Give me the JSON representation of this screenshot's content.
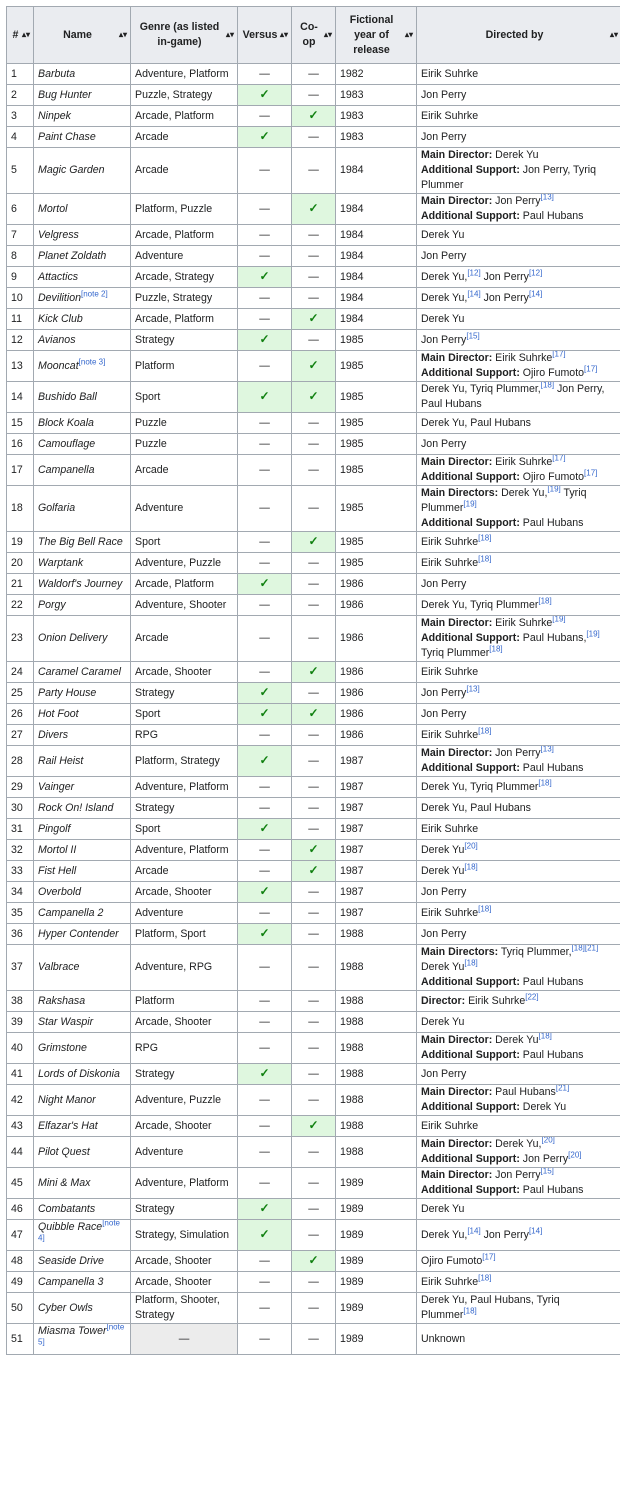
{
  "headers": [
    {
      "key": "num",
      "label": "#"
    },
    {
      "key": "name",
      "label": "Name"
    },
    {
      "key": "genre",
      "label": "Genre (as listed in-game)"
    },
    {
      "key": "versus",
      "label": "Versus"
    },
    {
      "key": "coop",
      "label": "Co-op"
    },
    {
      "key": "year",
      "label": "Fictional year of release"
    },
    {
      "key": "directed",
      "label": "Directed by"
    }
  ],
  "sort_icon": "sort-updown-icon",
  "check_symbol": "✓",
  "dash_symbol": "—",
  "colors": {
    "check_bg": "#dff7df",
    "mark_bg": "#ececec",
    "check_fg": "#108010",
    "link": "#3366cc",
    "header_bg": "#eaecf0",
    "border": "#a2a9b1"
  },
  "rows": [
    {
      "num": "1",
      "name": "Barbuta",
      "genre": "Adventure, Platform",
      "versus": false,
      "coop": false,
      "year": "1982",
      "directed": [
        [
          {
            "t": "Eirik Suhrke"
          }
        ]
      ]
    },
    {
      "num": "2",
      "name": "Bug Hunter",
      "genre": "Puzzle, Strategy",
      "versus": true,
      "coop": false,
      "year": "1983",
      "directed": [
        [
          {
            "t": "Jon Perry"
          }
        ]
      ]
    },
    {
      "num": "3",
      "name": "Ninpek",
      "genre": "Arcade, Platform",
      "versus": false,
      "coop": true,
      "year": "1983",
      "directed": [
        [
          {
            "t": "Eirik Suhrke"
          }
        ]
      ]
    },
    {
      "num": "4",
      "name": "Paint Chase",
      "genre": "Arcade",
      "versus": true,
      "coop": false,
      "year": "1983",
      "directed": [
        [
          {
            "t": "Jon Perry"
          }
        ]
      ]
    },
    {
      "num": "5",
      "name": "Magic Garden",
      "genre": "Arcade",
      "versus": false,
      "coop": false,
      "year": "1984",
      "directed": [
        [
          {
            "b": "Main Director:"
          },
          {
            "t": " Derek Yu"
          }
        ],
        [
          {
            "b": "Additional Support:"
          },
          {
            "t": " Jon Perry, Tyriq Plummer"
          }
        ]
      ]
    },
    {
      "num": "6",
      "name": "Mortol",
      "genre": "Platform, Puzzle",
      "versus": false,
      "coop": true,
      "year": "1984",
      "directed": [
        [
          {
            "b": "Main Director:"
          },
          {
            "t": " Jon Perry"
          },
          {
            "s": "[13]"
          }
        ],
        [
          {
            "b": "Additional Support:"
          },
          {
            "t": " Paul Hubans"
          }
        ]
      ]
    },
    {
      "num": "7",
      "name": "Velgress",
      "genre": "Arcade, Platform",
      "versus": false,
      "coop": false,
      "year": "1984",
      "directed": [
        [
          {
            "t": "Derek Yu"
          }
        ]
      ]
    },
    {
      "num": "8",
      "name": "Planet Zoldath",
      "genre": "Adventure",
      "versus": false,
      "coop": false,
      "year": "1984",
      "directed": [
        [
          {
            "t": "Jon Perry"
          }
        ]
      ]
    },
    {
      "num": "9",
      "name": "Attactics",
      "genre": "Arcade, Strategy",
      "versus": true,
      "coop": false,
      "year": "1984",
      "directed": [
        [
          {
            "t": "Derek Yu,"
          },
          {
            "s": "[12]"
          },
          {
            "t": " Jon Perry"
          },
          {
            "s": "[12]"
          }
        ]
      ]
    },
    {
      "num": "10",
      "name": "Devilition",
      "name_sup": "[note 2]",
      "genre": "Puzzle, Strategy",
      "versus": false,
      "coop": false,
      "year": "1984",
      "directed": [
        [
          {
            "t": "Derek Yu,"
          },
          {
            "s": "[14]"
          },
          {
            "t": " Jon Perry"
          },
          {
            "s": "[14]"
          }
        ]
      ]
    },
    {
      "num": "11",
      "name": "Kick Club",
      "genre": "Arcade, Platform",
      "versus": false,
      "coop": true,
      "year": "1984",
      "directed": [
        [
          {
            "t": "Derek Yu"
          }
        ]
      ]
    },
    {
      "num": "12",
      "name": "Avianos",
      "genre": "Strategy",
      "versus": true,
      "coop": false,
      "year": "1985",
      "directed": [
        [
          {
            "t": "Jon Perry"
          },
          {
            "s": "[15]"
          }
        ]
      ]
    },
    {
      "num": "13",
      "name": "Mooncat",
      "name_sup": "[note 3]",
      "genre": "Platform",
      "versus": false,
      "coop": true,
      "year": "1985",
      "directed": [
        [
          {
            "b": "Main Director:"
          },
          {
            "t": " Eirik Suhrke"
          },
          {
            "s": "[17]"
          }
        ],
        [
          {
            "b": "Additional Support:"
          },
          {
            "t": " Ojiro Fumoto"
          },
          {
            "s": "[17]"
          }
        ]
      ]
    },
    {
      "num": "14",
      "name": "Bushido Ball",
      "genre": "Sport",
      "versus": true,
      "coop": true,
      "year": "1985",
      "directed": [
        [
          {
            "t": "Derek Yu, Tyriq Plummer,"
          },
          {
            "s": "[18]"
          },
          {
            "t": " Jon Perry, Paul Hubans"
          }
        ]
      ]
    },
    {
      "num": "15",
      "name": "Block Koala",
      "genre": "Puzzle",
      "versus": false,
      "coop": false,
      "year": "1985",
      "directed": [
        [
          {
            "t": "Derek Yu, Paul Hubans"
          }
        ]
      ]
    },
    {
      "num": "16",
      "name": "Camouflage",
      "genre": "Puzzle",
      "versus": false,
      "coop": false,
      "year": "1985",
      "directed": [
        [
          {
            "t": "Jon Perry"
          }
        ]
      ]
    },
    {
      "num": "17",
      "name": "Campanella",
      "genre": "Arcade",
      "versus": false,
      "coop": false,
      "year": "1985",
      "directed": [
        [
          {
            "b": "Main Director:"
          },
          {
            "t": " Eirik Suhrke"
          },
          {
            "s": "[17]"
          }
        ],
        [
          {
            "b": "Additional Support:"
          },
          {
            "t": " Ojiro Fumoto"
          },
          {
            "s": "[17]"
          }
        ]
      ]
    },
    {
      "num": "18",
      "name": "Golfaria",
      "genre": "Adventure",
      "versus": false,
      "coop": false,
      "year": "1985",
      "directed": [
        [
          {
            "b": "Main Directors:"
          },
          {
            "t": " Derek Yu,"
          },
          {
            "s": "[19]"
          },
          {
            "t": " Tyriq Plummer"
          },
          {
            "s": "[19]"
          }
        ],
        [
          {
            "b": "Additional Support:"
          },
          {
            "t": " Paul Hubans"
          }
        ]
      ]
    },
    {
      "num": "19",
      "name": "The Big Bell Race",
      "genre": "Sport",
      "versus": false,
      "coop": true,
      "year": "1985",
      "directed": [
        [
          {
            "t": "Eirik Suhrke"
          },
          {
            "s": "[18]"
          }
        ]
      ]
    },
    {
      "num": "20",
      "name": "Warptank",
      "genre": "Adventure, Puzzle",
      "versus": false,
      "coop": false,
      "year": "1985",
      "directed": [
        [
          {
            "t": "Eirik Suhrke"
          },
          {
            "s": "[18]"
          }
        ]
      ]
    },
    {
      "num": "21",
      "name": "Waldorf's Journey",
      "genre": "Arcade, Platform",
      "versus": true,
      "coop": false,
      "year": "1986",
      "directed": [
        [
          {
            "t": "Jon Perry"
          }
        ]
      ]
    },
    {
      "num": "22",
      "name": "Porgy",
      "genre": "Adventure, Shooter",
      "versus": false,
      "coop": false,
      "year": "1986",
      "directed": [
        [
          {
            "t": "Derek Yu, Tyriq Plummer"
          },
          {
            "s": "[18]"
          }
        ]
      ]
    },
    {
      "num": "23",
      "name": "Onion Delivery",
      "genre": "Arcade",
      "versus": false,
      "coop": false,
      "year": "1986",
      "directed": [
        [
          {
            "b": "Main Director:"
          },
          {
            "t": " Eirik Suhrke"
          },
          {
            "s": "[19]"
          }
        ],
        [
          {
            "b": "Additional Support:"
          },
          {
            "t": " Paul Hubans,"
          },
          {
            "s": "[19]"
          },
          {
            "t": " Tyriq Plummer"
          },
          {
            "s": "[18]"
          }
        ]
      ]
    },
    {
      "num": "24",
      "name": "Caramel Caramel",
      "genre": "Arcade, Shooter",
      "versus": false,
      "coop": true,
      "year": "1986",
      "directed": [
        [
          {
            "t": "Eirik Suhrke"
          }
        ]
      ]
    },
    {
      "num": "25",
      "name": "Party House",
      "genre": "Strategy",
      "versus": true,
      "coop": false,
      "year": "1986",
      "directed": [
        [
          {
            "t": "Jon Perry"
          },
          {
            "s": "[13]"
          }
        ]
      ]
    },
    {
      "num": "26",
      "name": "Hot Foot",
      "genre": "Sport",
      "versus": true,
      "coop": true,
      "year": "1986",
      "directed": [
        [
          {
            "t": "Jon Perry"
          }
        ]
      ]
    },
    {
      "num": "27",
      "name": "Divers",
      "genre": "RPG",
      "versus": false,
      "coop": false,
      "year": "1986",
      "directed": [
        [
          {
            "t": "Eirik Suhrke"
          },
          {
            "s": "[18]"
          }
        ]
      ]
    },
    {
      "num": "28",
      "name": "Rail Heist",
      "genre": "Platform, Strategy",
      "versus": true,
      "coop": false,
      "year": "1987",
      "directed": [
        [
          {
            "b": "Main Director:"
          },
          {
            "t": " Jon Perry"
          },
          {
            "s": "[13]"
          }
        ],
        [
          {
            "b": "Additional Support:"
          },
          {
            "t": " Paul Hubans"
          }
        ]
      ]
    },
    {
      "num": "29",
      "name": "Vainger",
      "genre": "Adventure, Platform",
      "versus": false,
      "coop": false,
      "year": "1987",
      "directed": [
        [
          {
            "t": "Derek Yu, Tyriq Plummer"
          },
          {
            "s": "[18]"
          }
        ]
      ]
    },
    {
      "num": "30",
      "name": "Rock On! Island",
      "genre": "Strategy",
      "versus": false,
      "coop": false,
      "year": "1987",
      "directed": [
        [
          {
            "t": "Derek Yu, Paul Hubans"
          }
        ]
      ]
    },
    {
      "num": "31",
      "name": "Pingolf",
      "genre": "Sport",
      "versus": true,
      "coop": false,
      "year": "1987",
      "directed": [
        [
          {
            "t": "Eirik Suhrke"
          }
        ]
      ]
    },
    {
      "num": "32",
      "name": "Mortol II",
      "genre": "Adventure, Platform",
      "versus": false,
      "coop": true,
      "year": "1987",
      "directed": [
        [
          {
            "t": "Derek Yu"
          },
          {
            "s": "[20]"
          }
        ]
      ]
    },
    {
      "num": "33",
      "name": "Fist Hell",
      "genre": "Arcade",
      "versus": false,
      "coop": true,
      "year": "1987",
      "directed": [
        [
          {
            "t": "Derek Yu"
          },
          {
            "s": "[18]"
          }
        ]
      ]
    },
    {
      "num": "34",
      "name": "Overbold",
      "genre": "Arcade, Shooter",
      "versus": true,
      "coop": false,
      "year": "1987",
      "directed": [
        [
          {
            "t": "Jon Perry"
          }
        ]
      ]
    },
    {
      "num": "35",
      "name": "Campanella 2",
      "genre": "Adventure",
      "versus": false,
      "coop": false,
      "year": "1987",
      "directed": [
        [
          {
            "t": "Eirik Suhrke"
          },
          {
            "s": "[18]"
          }
        ]
      ]
    },
    {
      "num": "36",
      "name": "Hyper Contender",
      "genre": "Platform, Sport",
      "versus": true,
      "coop": false,
      "year": "1988",
      "directed": [
        [
          {
            "t": "Jon Perry"
          }
        ]
      ]
    },
    {
      "num": "37",
      "name": "Valbrace",
      "genre": "Adventure, RPG",
      "versus": false,
      "coop": false,
      "year": "1988",
      "directed": [
        [
          {
            "b": "Main Directors:"
          },
          {
            "t": " Tyriq Plummer,"
          },
          {
            "s": "[18][21]"
          },
          {
            "t": " Derek Yu"
          },
          {
            "s": "[18]"
          }
        ],
        [
          {
            "b": "Additional Support:"
          },
          {
            "t": " Paul Hubans"
          }
        ]
      ]
    },
    {
      "num": "38",
      "name": "Rakshasa",
      "genre": "Platform",
      "versus": false,
      "coop": false,
      "year": "1988",
      "directed": [
        [
          {
            "b": "Director:"
          },
          {
            "t": " Eirik Suhrke"
          },
          {
            "s": "[22]"
          }
        ]
      ]
    },
    {
      "num": "39",
      "name": "Star Waspir",
      "genre": "Arcade, Shooter",
      "versus": false,
      "coop": false,
      "year": "1988",
      "directed": [
        [
          {
            "t": "Derek Yu"
          }
        ]
      ]
    },
    {
      "num": "40",
      "name": "Grimstone",
      "genre": "RPG",
      "versus": false,
      "coop": false,
      "year": "1988",
      "directed": [
        [
          {
            "b": "Main Director:"
          },
          {
            "t": " Derek Yu"
          },
          {
            "s": "[18]"
          }
        ],
        [
          {
            "b": "Additional Support:"
          },
          {
            "t": " Paul Hubans"
          }
        ]
      ]
    },
    {
      "num": "41",
      "name": "Lords of Diskonia",
      "genre": "Strategy",
      "versus": true,
      "coop": false,
      "year": "1988",
      "directed": [
        [
          {
            "t": "Jon Perry"
          }
        ]
      ]
    },
    {
      "num": "42",
      "name": "Night Manor",
      "genre": "Adventure, Puzzle",
      "versus": false,
      "coop": false,
      "year": "1988",
      "directed": [
        [
          {
            "b": "Main Director:"
          },
          {
            "t": " Paul Hubans"
          },
          {
            "s": "[21]"
          }
        ],
        [
          {
            "b": "Additional Support:"
          },
          {
            "t": " Derek Yu"
          }
        ]
      ]
    },
    {
      "num": "43",
      "name": "Elfazar's Hat",
      "genre": "Arcade, Shooter",
      "versus": false,
      "coop": true,
      "year": "1988",
      "directed": [
        [
          {
            "t": "Eirik Suhrke"
          }
        ]
      ]
    },
    {
      "num": "44",
      "name": "Pilot Quest",
      "genre": "Adventure",
      "versus": false,
      "coop": false,
      "year": "1988",
      "directed": [
        [
          {
            "b": "Main Director:"
          },
          {
            "t": " Derek Yu,"
          },
          {
            "s": "[20]"
          }
        ],
        [
          {
            "b": "Additional Support:"
          },
          {
            "t": " Jon Perry"
          },
          {
            "s": "[20]"
          }
        ]
      ]
    },
    {
      "num": "45",
      "name": "Mini & Max",
      "genre": "Adventure, Platform",
      "versus": false,
      "coop": false,
      "year": "1989",
      "directed": [
        [
          {
            "b": "Main Director:"
          },
          {
            "t": " Jon Perry"
          },
          {
            "s": "[15]"
          }
        ],
        [
          {
            "b": "Additional Support:"
          },
          {
            "t": " Paul Hubans"
          }
        ]
      ]
    },
    {
      "num": "46",
      "name": "Combatants",
      "genre": "Strategy",
      "versus": true,
      "coop": false,
      "year": "1989",
      "directed": [
        [
          {
            "t": "Derek Yu"
          }
        ]
      ]
    },
    {
      "num": "47",
      "name": "Quibble Race",
      "name_sup": "[note 4]",
      "genre": "Strategy, Simulation",
      "versus": true,
      "coop": false,
      "year": "1989",
      "directed": [
        [
          {
            "t": "Derek Yu,"
          },
          {
            "s": "[14]"
          },
          {
            "t": " Jon Perry"
          },
          {
            "s": "[14]"
          }
        ]
      ]
    },
    {
      "num": "48",
      "name": "Seaside Drive",
      "genre": "Arcade, Shooter",
      "versus": false,
      "coop": true,
      "year": "1989",
      "directed": [
        [
          {
            "t": "Ojiro Fumoto"
          },
          {
            "s": "[17]"
          }
        ]
      ]
    },
    {
      "num": "49",
      "name": "Campanella 3",
      "genre": "Arcade, Shooter",
      "versus": false,
      "coop": false,
      "year": "1989",
      "directed": [
        [
          {
            "t": "Eirik Suhrke"
          },
          {
            "s": "[18]"
          }
        ]
      ]
    },
    {
      "num": "50",
      "name": "Cyber Owls",
      "genre": "Platform, Shooter, Strategy",
      "versus": false,
      "coop": false,
      "year": "1989",
      "directed": [
        [
          {
            "t": "Derek Yu, Paul Hubans, Tyriq Plummer"
          },
          {
            "s": "[18]"
          }
        ]
      ]
    },
    {
      "num": "51",
      "name": "Miasma Tower",
      "name_sup": "[note 5]",
      "genre": "—",
      "genre_na": true,
      "versus": false,
      "coop": false,
      "year": "1989",
      "directed": [
        [
          {
            "t": "Unknown"
          }
        ]
      ]
    }
  ]
}
